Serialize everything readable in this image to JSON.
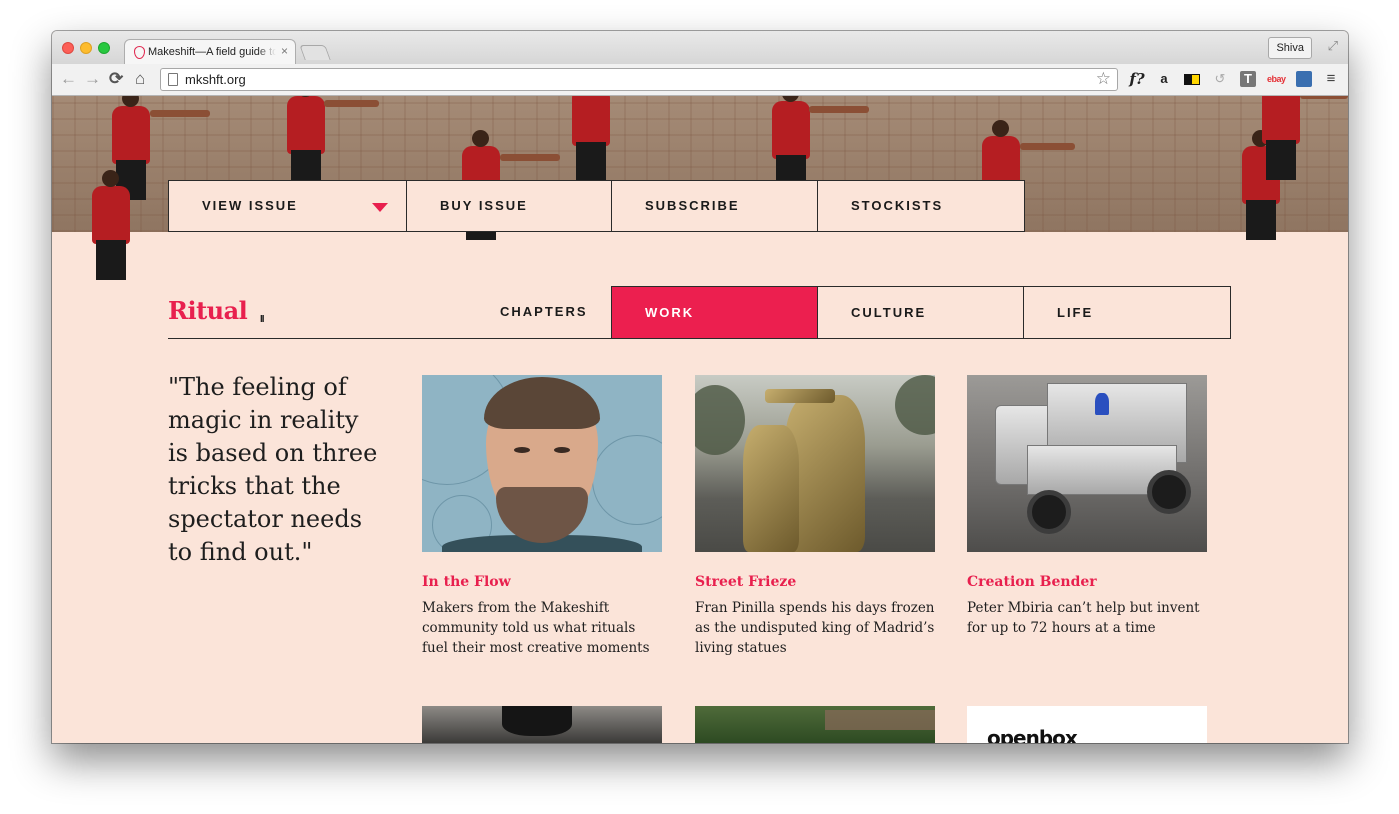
{
  "browser": {
    "tab_title": "Makeshift—A field guide to",
    "tab_close": "×",
    "user_name": "Shiva",
    "url": "mkshft.org",
    "icons": {
      "back": "←",
      "forward": "→",
      "reload": "C",
      "home": "⌂",
      "star": "☆",
      "fq": "f?",
      "amazon": "a",
      "undo": "↺",
      "t": "T",
      "ebay": "ebay",
      "menu": "≡",
      "expand": "⤢"
    }
  },
  "issue_nav": {
    "items": [
      {
        "label": "VIEW ISSUE"
      },
      {
        "label": "BUY ISSUE"
      },
      {
        "label": "SUBSCRIBE"
      },
      {
        "label": "STOCKISTS"
      }
    ]
  },
  "section": {
    "title": "Ritual",
    "pause_glyph": "II",
    "categories": [
      {
        "label": "CHAPTERS"
      },
      {
        "label": "WORK"
      },
      {
        "label": "CULTURE"
      },
      {
        "label": "LIFE"
      }
    ],
    "active_category": "WORK"
  },
  "quote": "\"The feeling of magic in reality is based on three tricks that the spectator needs to find out.\"",
  "cards": [
    {
      "title": "In the Flow",
      "description": "Makers from the Makeshift community told us what rituals fuel their most creative moments"
    },
    {
      "title": "Street Frieze",
      "description": "Fran Pinilla spends his days frozen as the undisputed king of Madrid’s living statues"
    },
    {
      "title": "Creation Bender",
      "description": "Peter Mbiria can’t help but invent for up to 72 hours at a time"
    }
  ],
  "bottom_cards": {
    "openbox_logo": "openbox"
  },
  "colors": {
    "accent": "#e8204e",
    "page_background": "#fbe4d9",
    "text": "#1e1e1e"
  }
}
